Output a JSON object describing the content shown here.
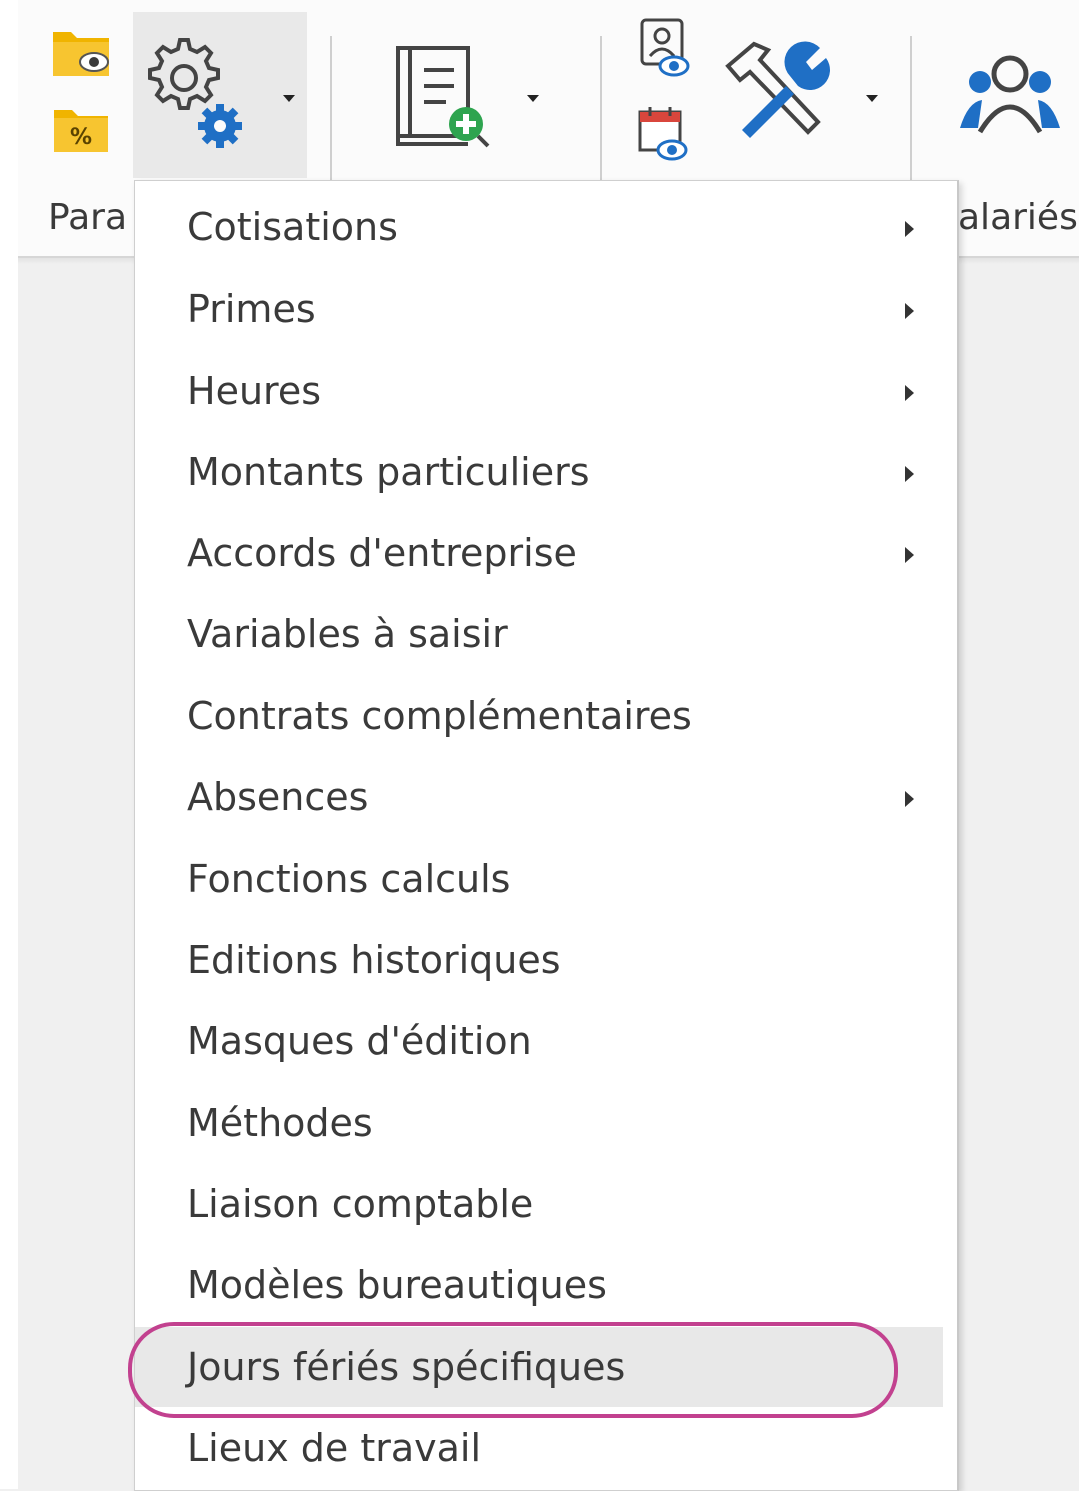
{
  "ribbon": {
    "group_param_label": "Para",
    "group_salaries_label": "alariés"
  },
  "settings_menu": {
    "items": [
      {
        "label": "Cotisations",
        "has_submenu": true
      },
      {
        "label": "Primes",
        "has_submenu": true
      },
      {
        "label": "Heures",
        "has_submenu": true
      },
      {
        "label": "Montants particuliers",
        "has_submenu": true
      },
      {
        "label": "Accords d'entreprise",
        "has_submenu": true
      },
      {
        "label": "Variables à saisir",
        "has_submenu": false
      },
      {
        "label": "Contrats complémentaires",
        "has_submenu": false
      },
      {
        "label": "Absences",
        "has_submenu": true
      },
      {
        "label": "Fonctions calculs",
        "has_submenu": false
      },
      {
        "label": "Editions historiques",
        "has_submenu": false
      },
      {
        "label": "Masques d'édition",
        "has_submenu": false
      },
      {
        "label": "Méthodes",
        "has_submenu": false
      },
      {
        "label": "Liaison comptable",
        "has_submenu": false
      },
      {
        "label": "Modèles bureautiques",
        "has_submenu": false
      },
      {
        "label": "Jours fériés spécifiques",
        "has_submenu": false,
        "hovered": true,
        "highlighted": true
      },
      {
        "label": "Lieux de travail",
        "has_submenu": false
      }
    ]
  },
  "colors": {
    "accent_blue": "#1f6fc5",
    "folder_yellow": "#f0b400",
    "highlight_ring": "#c2418f",
    "hover_bg": "#e8e8e8",
    "calendar_red": "#d9463c"
  },
  "icons": [
    "folder-view-icon",
    "folder-percent-icon",
    "settings-gear-icon",
    "new-document-icon",
    "person-view-icon",
    "calendar-view-icon",
    "tools-icon",
    "users-icon"
  ]
}
